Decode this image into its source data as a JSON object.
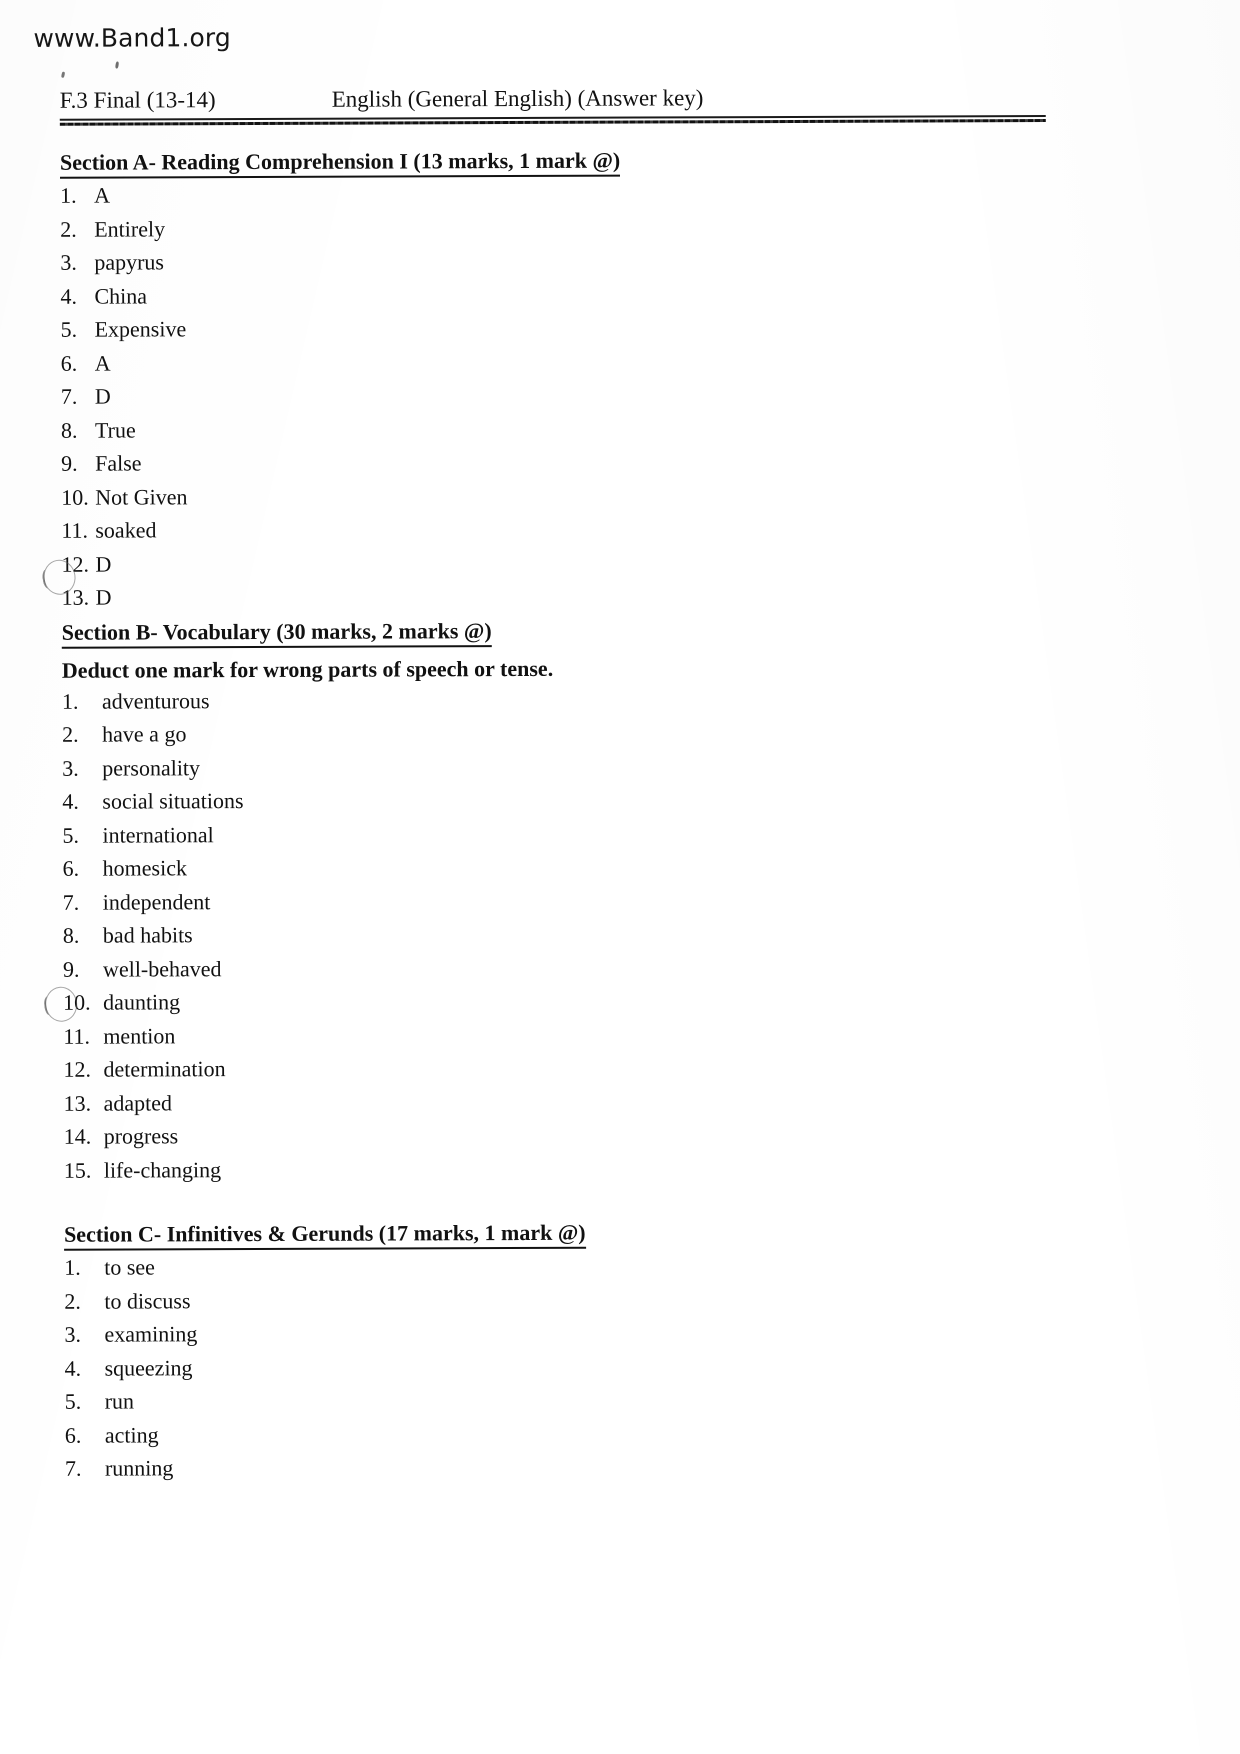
{
  "watermark": "www.Band1.org",
  "header": {
    "exam_code": "F.3 Final (13-14)",
    "exam_title": "English (General English) (Answer key)"
  },
  "sections": [
    {
      "heading": "Section A- Reading Comprehension I (13 marks, 1 mark @)",
      "subheading": null,
      "items": [
        {
          "number": "1.",
          "answer": "A"
        },
        {
          "number": "2.",
          "answer": "Entirely"
        },
        {
          "number": "3.",
          "answer": "papyrus"
        },
        {
          "number": "4.",
          "answer": "China"
        },
        {
          "number": "5.",
          "answer": "Expensive"
        },
        {
          "number": "6.",
          "answer": "A"
        },
        {
          "number": "7.",
          "answer": "D"
        },
        {
          "number": "8.",
          "answer": "True"
        },
        {
          "number": "9.",
          "answer": "False"
        },
        {
          "number": "10.",
          "answer": "Not Given"
        },
        {
          "number": "11.",
          "answer": "soaked"
        },
        {
          "number": "12.",
          "answer": "D"
        },
        {
          "number": "13.",
          "answer": "D"
        }
      ]
    },
    {
      "heading": "Section B- Vocabulary (30 marks, 2 marks @)",
      "subheading": "Deduct one mark for wrong parts of speech or tense.",
      "items": [
        {
          "number": "1.",
          "answer": "adventurous"
        },
        {
          "number": "2.",
          "answer": "have a go"
        },
        {
          "number": "3.",
          "answer": "personality"
        },
        {
          "number": "4.",
          "answer": "social situations"
        },
        {
          "number": "5.",
          "answer": "international"
        },
        {
          "number": "6.",
          "answer": "homesick"
        },
        {
          "number": "7.",
          "answer": "independent"
        },
        {
          "number": "8.",
          "answer": "bad habits"
        },
        {
          "number": "9.",
          "answer": "well-behaved"
        },
        {
          "number": "10.",
          "answer": "daunting"
        },
        {
          "number": "11.",
          "answer": "mention"
        },
        {
          "number": "12.",
          "answer": "determination"
        },
        {
          "number": "13.",
          "answer": "adapted"
        },
        {
          "number": "14.",
          "answer": "progress"
        },
        {
          "number": "15.",
          "answer": "life-changing"
        }
      ]
    },
    {
      "heading": "Section C- Infinitives & Gerunds (17 marks, 1 mark @)",
      "subheading": null,
      "items": [
        {
          "number": "1.",
          "answer": "to see"
        },
        {
          "number": "2.",
          "answer": "to discuss"
        },
        {
          "number": "3.",
          "answer": "examining"
        },
        {
          "number": "4.",
          "answer": "squeezing"
        },
        {
          "number": "5.",
          "answer": "run"
        },
        {
          "number": "6.",
          "answer": "acting"
        },
        {
          "number": "7.",
          "answer": "running"
        }
      ]
    }
  ]
}
